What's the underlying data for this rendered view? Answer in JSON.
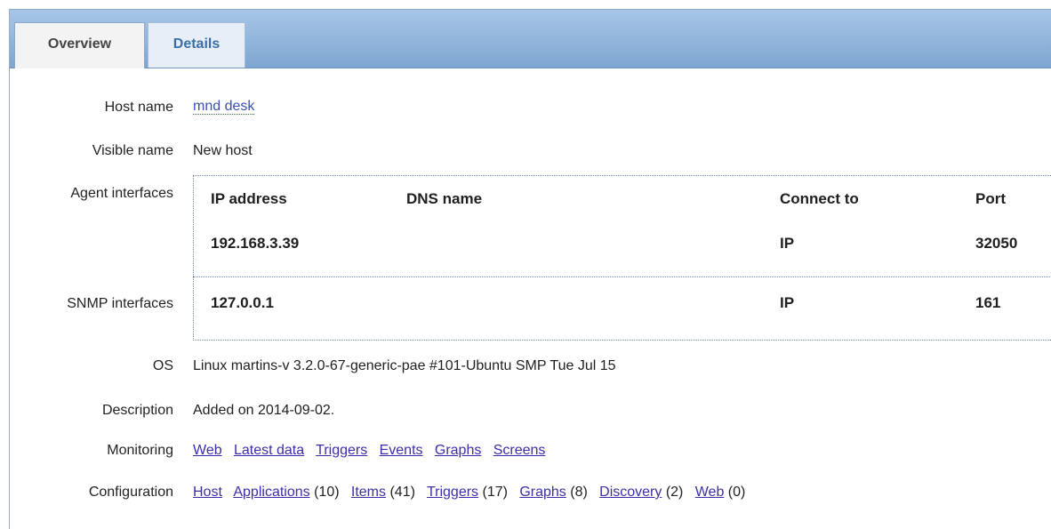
{
  "tabs": {
    "overview": "Overview",
    "details": "Details"
  },
  "host": {
    "host_name_label": "Host name",
    "host_name": "mnd desk",
    "visible_name_label": "Visible name",
    "visible_name": "New host",
    "agent_interfaces_label": "Agent interfaces",
    "snmp_interfaces_label": "SNMP interfaces",
    "os_label": "OS",
    "os": "Linux martins-v 3.2.0-67-generic-pae #101-Ubuntu SMP Tue Jul 15",
    "description_label": "Description",
    "description": "Added on 2014-09-02.",
    "monitoring_label": "Monitoring",
    "configuration_label": "Configuration"
  },
  "interfaces": {
    "headers": {
      "ip": "IP address",
      "dns": "DNS name",
      "connect": "Connect to",
      "port": "Port"
    },
    "agent": {
      "ip": "192.168.3.39",
      "dns": "",
      "connect": "IP",
      "port": "32050"
    },
    "snmp": {
      "ip": "127.0.0.1",
      "dns": "",
      "connect": "IP",
      "port": "161"
    }
  },
  "monitoring": {
    "web": "Web",
    "latest": "Latest data",
    "triggers": "Triggers",
    "events": "Events",
    "graphs": "Graphs",
    "screens": "Screens"
  },
  "configuration": {
    "host": "Host",
    "applications": "Applications",
    "applications_count": "(10)",
    "items": "Items",
    "items_count": "(41)",
    "triggers": "Triggers",
    "triggers_count": "(17)",
    "graphs": "Graphs",
    "graphs_count": "(8)",
    "discovery": "Discovery",
    "discovery_count": "(2)",
    "web": "Web",
    "web_count": "(0)"
  }
}
